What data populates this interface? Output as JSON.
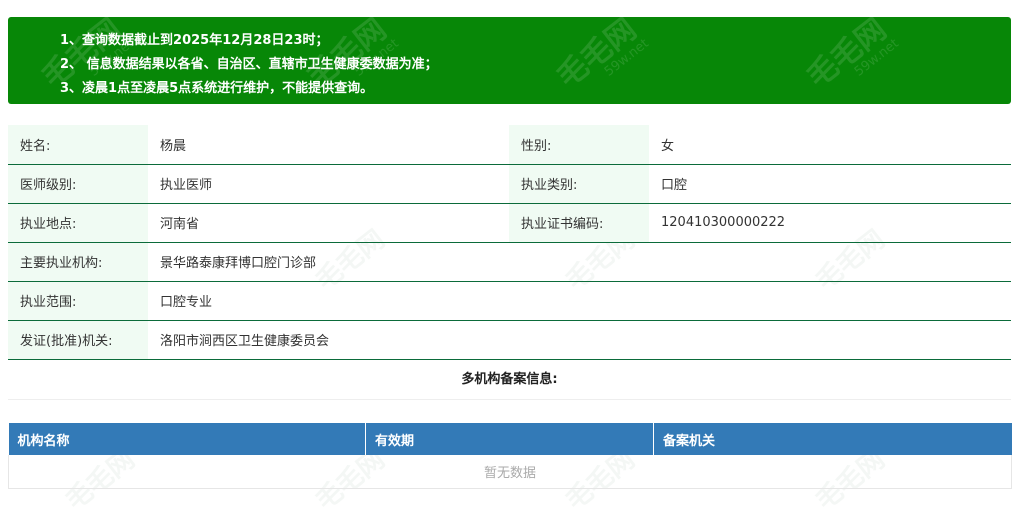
{
  "notice": {
    "lines": [
      "1、查询数据截止到2025年12月28日23时；",
      "2、 信息数据结果以各省、自治区、直辖市卫生健康委数据为准；",
      "3、凌晨1点至凌晨5点系统进行维护，不能提供查询。"
    ],
    "background_color": "#078707"
  },
  "watermark": {
    "name": "毛毛网",
    "domain": "59w.net"
  },
  "doctor": {
    "name_label": "姓名:",
    "name_value": "杨晨",
    "gender_label": "性别:",
    "gender_value": "女",
    "level_label": "医师级别:",
    "level_value": "执业医师",
    "category_label": "执业类别:",
    "category_value": "口腔",
    "location_label": "执业地点:",
    "location_value": "河南省",
    "cert_label": "执业证书编码:",
    "cert_value": "120410300000222",
    "institution_label": "主要执业机构:",
    "institution_value": "景华路泰康拜博口腔门诊部",
    "scope_label": "执业范围:",
    "scope_value": "口腔专业",
    "issuer_label": "发证(批准)机关:",
    "issuer_value": "洛阳市涧西区卫生健康委员会"
  },
  "multi_institution": {
    "title": "多机构备案信息:",
    "columns": [
      "机构名称",
      "有效期",
      "备案机关"
    ],
    "empty_text": "暂无数据",
    "header_color": "#337ab7"
  }
}
